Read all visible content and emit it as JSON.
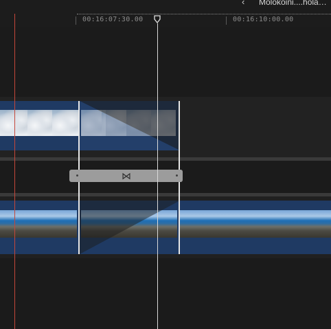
{
  "header": {
    "clip_name": "Molokoini....hola…",
    "back_icon": "chevron-left-icon"
  },
  "ruler": {
    "timecodes": [
      "00:16:07:30.00",
      "00:16:10:00.00"
    ]
  },
  "transition": {
    "icon": "bowtie-transition-icon",
    "glyph": "⋈"
  },
  "colors": {
    "clip_blue": "#1f3a63",
    "skimmer": "#c5473a",
    "playhead": "#d9d9d9"
  }
}
